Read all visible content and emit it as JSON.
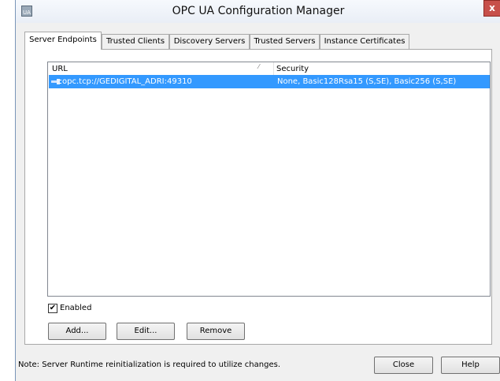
{
  "window": {
    "title": "OPC UA Configuration Manager",
    "close_label": "x"
  },
  "tabs": [
    {
      "label": "Server Endpoints"
    },
    {
      "label": "Trusted Clients"
    },
    {
      "label": "Discovery Servers"
    },
    {
      "label": "Trusted Servers"
    },
    {
      "label": "Instance Certificates"
    }
  ],
  "list": {
    "headers": {
      "url": "URL",
      "security": "Security"
    },
    "rows": [
      {
        "url": "opc.tcp://GEDIGITAL_ADRI:49310",
        "security": "None, Basic128Rsa15 (S,SE), Basic256 (S,SE)",
        "selected": true
      }
    ]
  },
  "enabled": {
    "label": "Enabled",
    "checked": true,
    "mark": "✔"
  },
  "buttons": {
    "add": "Add...",
    "edit": "Edit...",
    "remove": "Remove",
    "close": "Close",
    "help": "Help"
  },
  "footer": {
    "note": "Note:  Server Runtime reinitialization is required to utilize changes."
  },
  "colors": {
    "selection": "#3399ff",
    "close_button": "#c7504a"
  }
}
